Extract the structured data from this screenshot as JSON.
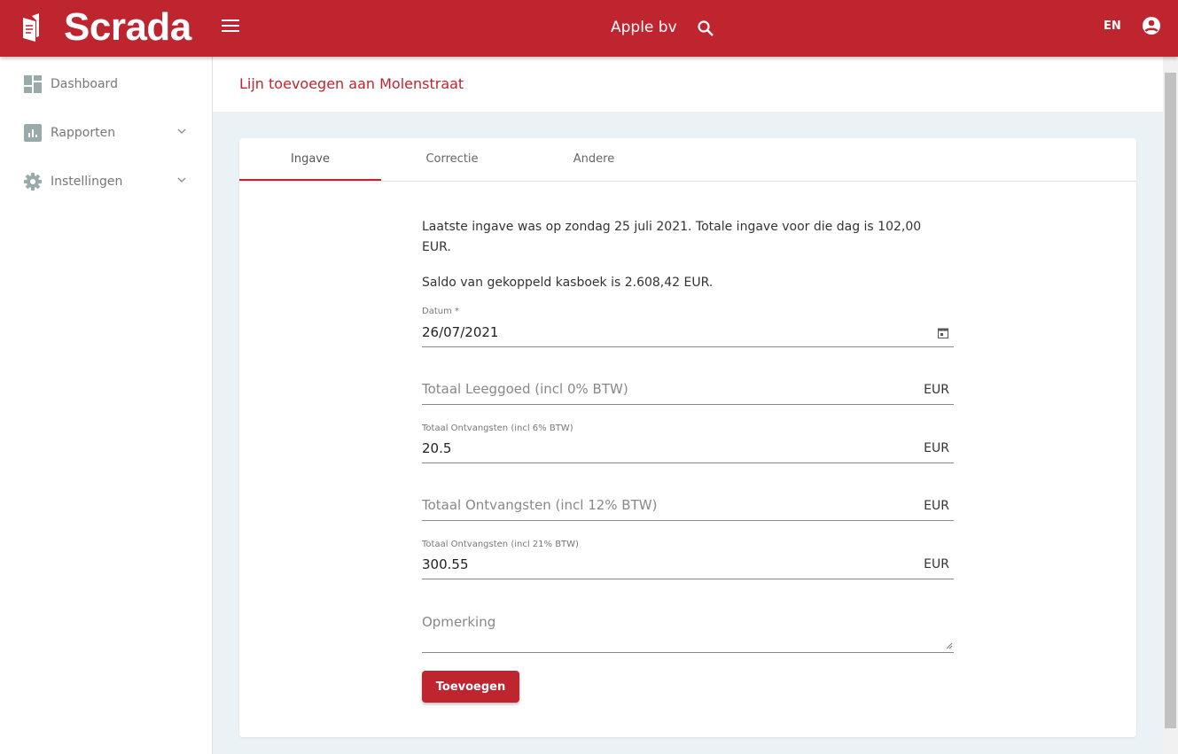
{
  "header": {
    "logo": "Scrada",
    "company": "Apple bv",
    "language": "EN"
  },
  "sidebar": {
    "items": [
      {
        "label": "Dashboard"
      },
      {
        "label": "Rapporten"
      },
      {
        "label": "Instellingen"
      }
    ]
  },
  "page": {
    "title": "Lijn toevoegen aan Molenstraat"
  },
  "tabs": [
    {
      "label": "Ingave"
    },
    {
      "label": "Correctie"
    },
    {
      "label": "Andere"
    }
  ],
  "form": {
    "info1": "Laatste ingave was op zondag 25 juli 2021. Totale ingave voor die dag is 102,00 EUR.",
    "info2": "Saldo van gekoppeld kasboek is 2.608,42 EUR.",
    "datum_label": "Datum *",
    "datum_value": "26/07/2021",
    "currency": "EUR",
    "leeggoed_placeholder": "Totaal Leeggoed (incl 0% BTW)",
    "ontv6_label": "Totaal Ontvangsten (incl 6% BTW)",
    "ontv6_value": "20.5",
    "ontv12_placeholder": "Totaal Ontvangsten (incl 12% BTW)",
    "ontv21_label": "Totaal Ontvangsten (incl 21% BTW)",
    "ontv21_value": "300.55",
    "opmerking_placeholder": "Opmerking",
    "submit": "Toevoegen"
  },
  "colors": {
    "brand": "#be252f",
    "background": "#ebf2f5"
  }
}
